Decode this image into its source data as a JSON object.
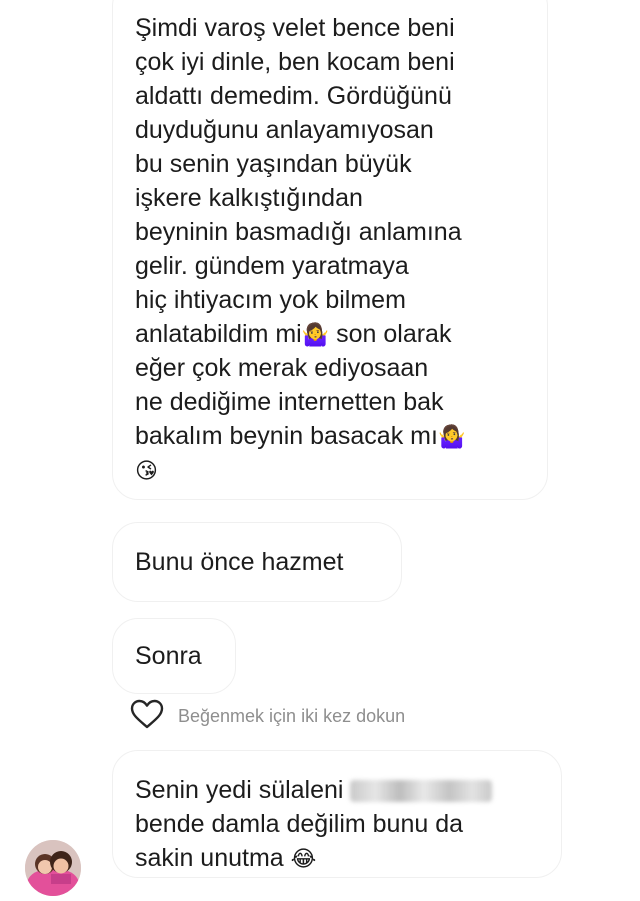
{
  "thread": {
    "message_1": {
      "lines": [
        "Şimdi varoş velet bence beni",
        "çok iyi dinle, ben kocam beni",
        "aldattı demedim. Gördüğünü",
        "duyduğunu anlayamıyosan",
        "bu senin yaşından büyük",
        "işkere kalkıştığından",
        "beyninin basmadığı anlamına",
        "gelir. gündem yaratmaya",
        "hiç ihtiyacım yok bilmem",
        "anlatabildim mi",
        "son olarak",
        "eğer çok merak ediyosaan",
        "ne dediğime internetten bak",
        "bakalım beynin basacak mı"
      ],
      "emoji_shrug": "🤷‍♀️",
      "emoji_kiss": "😘"
    },
    "message_2": {
      "text": "Bunu önce hazmet"
    },
    "message_3": {
      "text": "Sonra"
    },
    "like_hint": {
      "text": "Beğenmek için iki kez dokun",
      "icon": "heart-outline-icon"
    },
    "message_4": {
      "line1_prefix": "Senin yedi sülaleni",
      "line2": "bende damla değilim bunu da",
      "line3": "sakin unutma",
      "emoji_laugh": "😂"
    }
  },
  "colors": {
    "background": "#ffffff",
    "text": "#1c1c1c",
    "muted": "#8e8e8e",
    "bubble_border": "#f0f0f0"
  }
}
